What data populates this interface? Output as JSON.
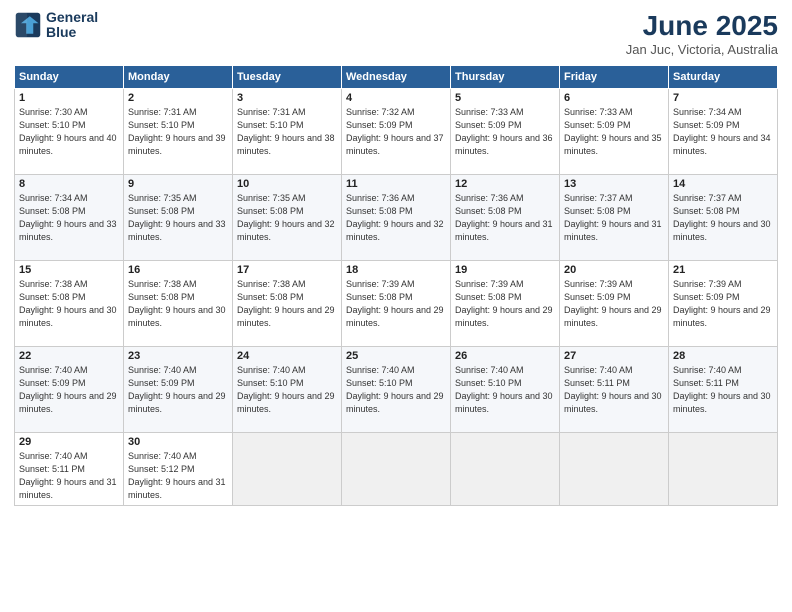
{
  "logo": {
    "line1": "General",
    "line2": "Blue"
  },
  "title": "June 2025",
  "subtitle": "Jan Juc, Victoria, Australia",
  "days_of_week": [
    "Sunday",
    "Monday",
    "Tuesday",
    "Wednesday",
    "Thursday",
    "Friday",
    "Saturday"
  ],
  "weeks": [
    [
      {
        "day": "1",
        "sunrise": "Sunrise: 7:30 AM",
        "sunset": "Sunset: 5:10 PM",
        "daylight": "Daylight: 9 hours and 40 minutes."
      },
      {
        "day": "2",
        "sunrise": "Sunrise: 7:31 AM",
        "sunset": "Sunset: 5:10 PM",
        "daylight": "Daylight: 9 hours and 39 minutes."
      },
      {
        "day": "3",
        "sunrise": "Sunrise: 7:31 AM",
        "sunset": "Sunset: 5:10 PM",
        "daylight": "Daylight: 9 hours and 38 minutes."
      },
      {
        "day": "4",
        "sunrise": "Sunrise: 7:32 AM",
        "sunset": "Sunset: 5:09 PM",
        "daylight": "Daylight: 9 hours and 37 minutes."
      },
      {
        "day": "5",
        "sunrise": "Sunrise: 7:33 AM",
        "sunset": "Sunset: 5:09 PM",
        "daylight": "Daylight: 9 hours and 36 minutes."
      },
      {
        "day": "6",
        "sunrise": "Sunrise: 7:33 AM",
        "sunset": "Sunset: 5:09 PM",
        "daylight": "Daylight: 9 hours and 35 minutes."
      },
      {
        "day": "7",
        "sunrise": "Sunrise: 7:34 AM",
        "sunset": "Sunset: 5:09 PM",
        "daylight": "Daylight: 9 hours and 34 minutes."
      }
    ],
    [
      {
        "day": "8",
        "sunrise": "Sunrise: 7:34 AM",
        "sunset": "Sunset: 5:08 PM",
        "daylight": "Daylight: 9 hours and 33 minutes."
      },
      {
        "day": "9",
        "sunrise": "Sunrise: 7:35 AM",
        "sunset": "Sunset: 5:08 PM",
        "daylight": "Daylight: 9 hours and 33 minutes."
      },
      {
        "day": "10",
        "sunrise": "Sunrise: 7:35 AM",
        "sunset": "Sunset: 5:08 PM",
        "daylight": "Daylight: 9 hours and 32 minutes."
      },
      {
        "day": "11",
        "sunrise": "Sunrise: 7:36 AM",
        "sunset": "Sunset: 5:08 PM",
        "daylight": "Daylight: 9 hours and 32 minutes."
      },
      {
        "day": "12",
        "sunrise": "Sunrise: 7:36 AM",
        "sunset": "Sunset: 5:08 PM",
        "daylight": "Daylight: 9 hours and 31 minutes."
      },
      {
        "day": "13",
        "sunrise": "Sunrise: 7:37 AM",
        "sunset": "Sunset: 5:08 PM",
        "daylight": "Daylight: 9 hours and 31 minutes."
      },
      {
        "day": "14",
        "sunrise": "Sunrise: 7:37 AM",
        "sunset": "Sunset: 5:08 PM",
        "daylight": "Daylight: 9 hours and 30 minutes."
      }
    ],
    [
      {
        "day": "15",
        "sunrise": "Sunrise: 7:38 AM",
        "sunset": "Sunset: 5:08 PM",
        "daylight": "Daylight: 9 hours and 30 minutes."
      },
      {
        "day": "16",
        "sunrise": "Sunrise: 7:38 AM",
        "sunset": "Sunset: 5:08 PM",
        "daylight": "Daylight: 9 hours and 30 minutes."
      },
      {
        "day": "17",
        "sunrise": "Sunrise: 7:38 AM",
        "sunset": "Sunset: 5:08 PM",
        "daylight": "Daylight: 9 hours and 29 minutes."
      },
      {
        "day": "18",
        "sunrise": "Sunrise: 7:39 AM",
        "sunset": "Sunset: 5:08 PM",
        "daylight": "Daylight: 9 hours and 29 minutes."
      },
      {
        "day": "19",
        "sunrise": "Sunrise: 7:39 AM",
        "sunset": "Sunset: 5:08 PM",
        "daylight": "Daylight: 9 hours and 29 minutes."
      },
      {
        "day": "20",
        "sunrise": "Sunrise: 7:39 AM",
        "sunset": "Sunset: 5:09 PM",
        "daylight": "Daylight: 9 hours and 29 minutes."
      },
      {
        "day": "21",
        "sunrise": "Sunrise: 7:39 AM",
        "sunset": "Sunset: 5:09 PM",
        "daylight": "Daylight: 9 hours and 29 minutes."
      }
    ],
    [
      {
        "day": "22",
        "sunrise": "Sunrise: 7:40 AM",
        "sunset": "Sunset: 5:09 PM",
        "daylight": "Daylight: 9 hours and 29 minutes."
      },
      {
        "day": "23",
        "sunrise": "Sunrise: 7:40 AM",
        "sunset": "Sunset: 5:09 PM",
        "daylight": "Daylight: 9 hours and 29 minutes."
      },
      {
        "day": "24",
        "sunrise": "Sunrise: 7:40 AM",
        "sunset": "Sunset: 5:10 PM",
        "daylight": "Daylight: 9 hours and 29 minutes."
      },
      {
        "day": "25",
        "sunrise": "Sunrise: 7:40 AM",
        "sunset": "Sunset: 5:10 PM",
        "daylight": "Daylight: 9 hours and 29 minutes."
      },
      {
        "day": "26",
        "sunrise": "Sunrise: 7:40 AM",
        "sunset": "Sunset: 5:10 PM",
        "daylight": "Daylight: 9 hours and 30 minutes."
      },
      {
        "day": "27",
        "sunrise": "Sunrise: 7:40 AM",
        "sunset": "Sunset: 5:11 PM",
        "daylight": "Daylight: 9 hours and 30 minutes."
      },
      {
        "day": "28",
        "sunrise": "Sunrise: 7:40 AM",
        "sunset": "Sunset: 5:11 PM",
        "daylight": "Daylight: 9 hours and 30 minutes."
      }
    ],
    [
      {
        "day": "29",
        "sunrise": "Sunrise: 7:40 AM",
        "sunset": "Sunset: 5:11 PM",
        "daylight": "Daylight: 9 hours and 31 minutes."
      },
      {
        "day": "30",
        "sunrise": "Sunrise: 7:40 AM",
        "sunset": "Sunset: 5:12 PM",
        "daylight": "Daylight: 9 hours and 31 minutes."
      },
      null,
      null,
      null,
      null,
      null
    ]
  ]
}
